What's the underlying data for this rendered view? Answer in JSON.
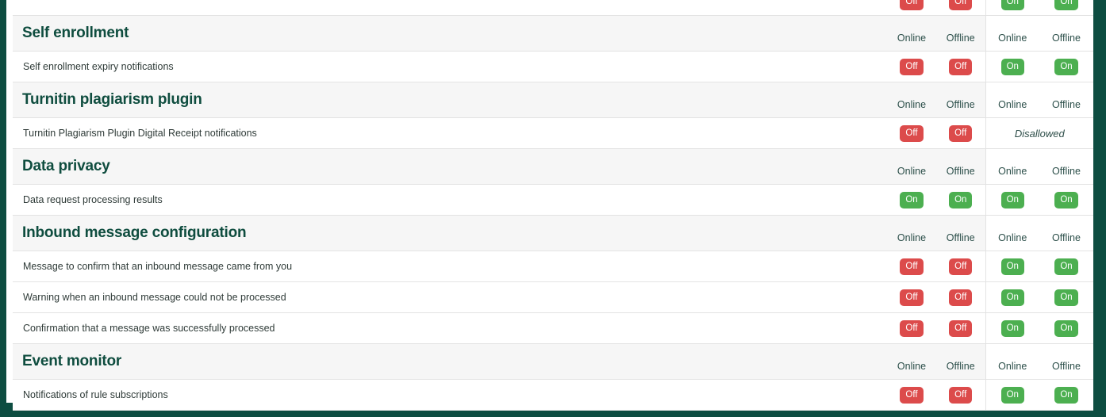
{
  "theme": {
    "rail_color": "#0d4d41",
    "heading_color": "#0f4d3f",
    "on_color": "#4caf50",
    "off_color": "#dc4b4b",
    "head_row_bg": "#f6f6f6",
    "border_color": "#e3e3e3"
  },
  "column_headers": {
    "online": "Online",
    "offline": "Offline"
  },
  "badges": {
    "on": "On",
    "off": "Off",
    "disallowed": "Disallowed"
  },
  "sections": [
    {
      "title": "Self enrollment",
      "rows": [
        {
          "label": "Self enrollment expiry notifications",
          "values": [
            "Off",
            "Off",
            "On",
            "On"
          ],
          "disallowed": false
        }
      ]
    },
    {
      "title": "Turnitin plagiarism plugin",
      "rows": [
        {
          "label": "Turnitin Plagiarism Plugin Digital Receipt notifications",
          "values": [
            "Off",
            "Off",
            null,
            null
          ],
          "disallowed": true
        }
      ]
    },
    {
      "title": "Data privacy",
      "rows": [
        {
          "label": "Data request processing results",
          "values": [
            "On",
            "On",
            "On",
            "On"
          ],
          "disallowed": false
        }
      ]
    },
    {
      "title": "Inbound message configuration",
      "rows": [
        {
          "label": "Message to confirm that an inbound message came from you",
          "values": [
            "Off",
            "Off",
            "On",
            "On"
          ],
          "disallowed": false
        },
        {
          "label": "Warning when an inbound message could not be processed",
          "values": [
            "Off",
            "Off",
            "On",
            "On"
          ],
          "disallowed": false
        },
        {
          "label": "Confirmation that a message was successfully processed",
          "values": [
            "Off",
            "Off",
            "On",
            "On"
          ],
          "disallowed": false
        }
      ]
    },
    {
      "title": "Event monitor",
      "rows": [
        {
          "label": "Notifications of rule subscriptions",
          "values": [
            "Off",
            "Off",
            "On",
            "On"
          ],
          "disallowed": false
        }
      ]
    }
  ],
  "clipped_top_row": {
    "values": [
      "Off",
      "Off",
      "On",
      "On"
    ]
  }
}
